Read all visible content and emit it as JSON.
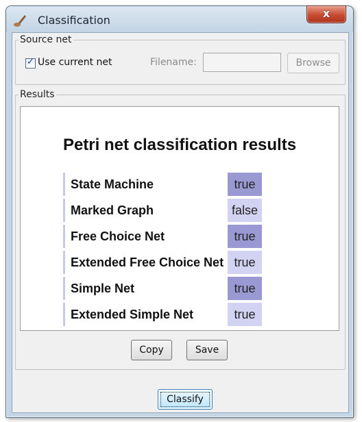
{
  "window": {
    "title": "Classification",
    "close_label": "x"
  },
  "source_net": {
    "legend": "Source net",
    "use_current_label": "Use current net",
    "use_current_checked": true,
    "filename_label": "Filename:",
    "filename_value": "",
    "browse_label": "Browse"
  },
  "results": {
    "legend": "Results",
    "heading": "Petri net classification results",
    "rows": [
      {
        "name": "State Machine",
        "value": "true",
        "color": "#9a99d4"
      },
      {
        "name": "Marked Graph",
        "value": "false",
        "color": "#d2d2f2"
      },
      {
        "name": "Free Choice Net",
        "value": "true",
        "color": "#9a99d4"
      },
      {
        "name": "Extended Free Choice Net",
        "value": "true",
        "color": "#d2d2f2"
      },
      {
        "name": "Simple Net",
        "value": "true",
        "color": "#9a99d4"
      },
      {
        "name": "Extended Simple Net",
        "value": "true",
        "color": "#d2d2f2"
      }
    ],
    "copy_label": "Copy",
    "save_label": "Save"
  },
  "classify_label": "Classify"
}
